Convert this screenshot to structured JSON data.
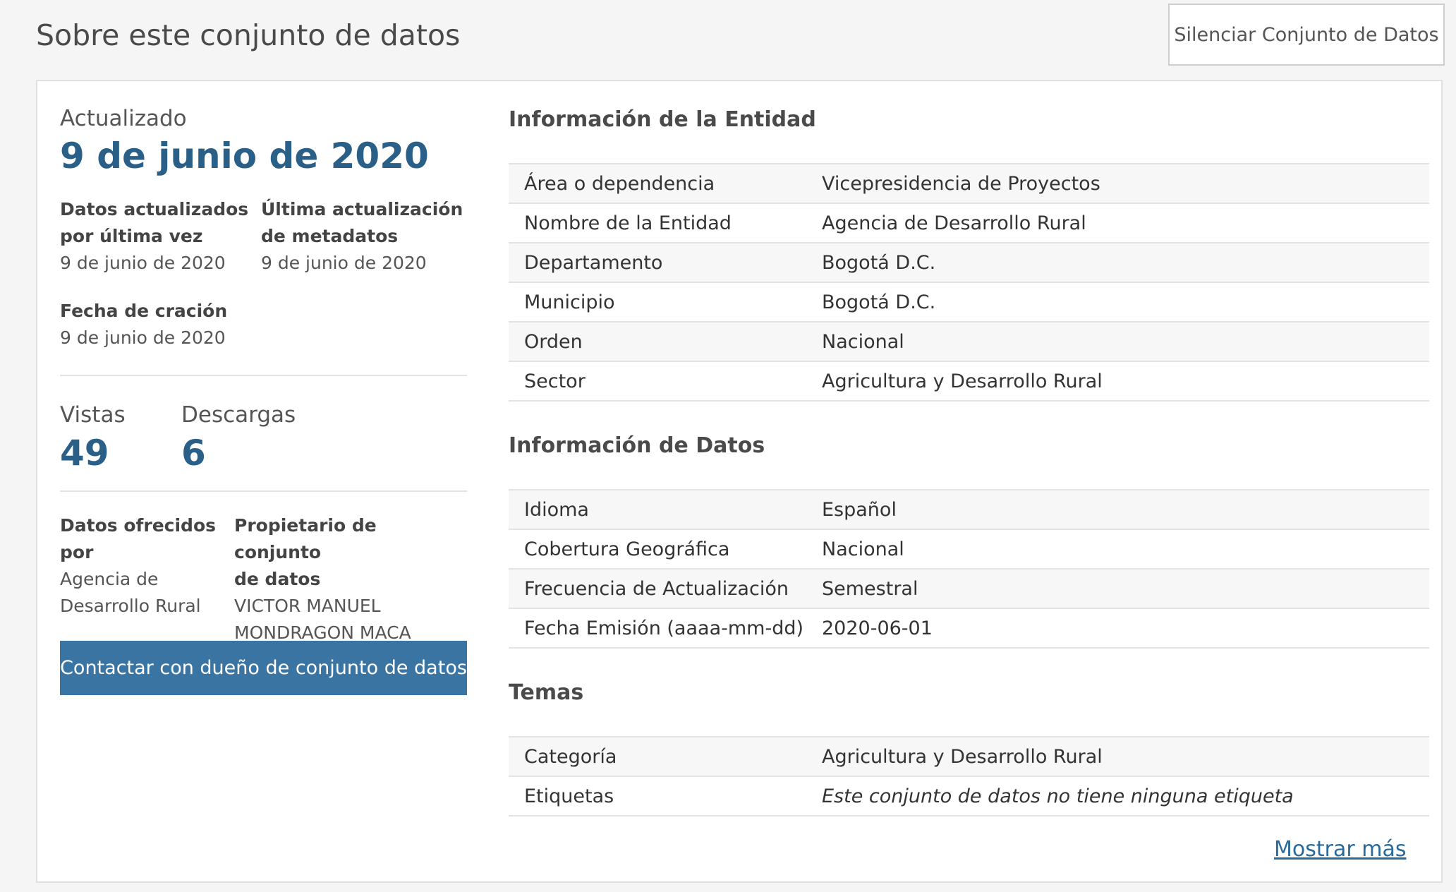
{
  "header": {
    "title": "Sobre este conjunto de datos",
    "mute_button_label": "Silenciar Conjunto de Datos"
  },
  "summary": {
    "updated_label": "Actualizado",
    "updated_date": "9 de junio de 2020",
    "data_updated_label_1": "Datos actualizados",
    "data_updated_label_2": "por última vez",
    "data_updated_value": "9 de junio de 2020",
    "metadata_updated_label_1": "Última actualización",
    "metadata_updated_label_2": "de metadatos",
    "metadata_updated_value": "9 de junio de 2020",
    "created_label": "Fecha de cración",
    "created_value": "9 de junio de 2020",
    "views_label": "Vistas",
    "views_value": "49",
    "downloads_label": "Descargas",
    "downloads_value": "6",
    "offered_by_label_1": "Datos ofrecidos",
    "offered_by_label_2": "por",
    "offered_by_value_1": "Agencia de",
    "offered_by_value_2": "Desarrollo Rural",
    "owner_label_1": "Propietario de conjunto",
    "owner_label_2": "de datos",
    "owner_value_1": "VICTOR MANUEL",
    "owner_value_2": "MONDRAGON MACA",
    "contact_button_label": "Contactar con dueño de conjunto de datos"
  },
  "entity_info": {
    "title": "Información de la Entidad",
    "rows": [
      {
        "key": "Área o dependencia",
        "value": "Vicepresidencia de Proyectos"
      },
      {
        "key": "Nombre de la Entidad",
        "value": "Agencia de Desarrollo Rural"
      },
      {
        "key": "Departamento",
        "value": "Bogotá D.C."
      },
      {
        "key": "Municipio",
        "value": "Bogotá D.C."
      },
      {
        "key": "Orden",
        "value": "Nacional"
      },
      {
        "key": "Sector",
        "value": "Agricultura y Desarrollo Rural"
      }
    ]
  },
  "data_info": {
    "title": "Información de Datos",
    "rows": [
      {
        "key": "Idioma",
        "value": "Español"
      },
      {
        "key": "Cobertura Geográfica",
        "value": "Nacional"
      },
      {
        "key": "Frecuencia de Actualización",
        "value": "Semestral"
      },
      {
        "key": "Fecha Emisión (aaaa-mm-dd)",
        "value": "2020-06-01"
      }
    ]
  },
  "topics": {
    "title": "Temas",
    "rows": [
      {
        "key": "Categoría",
        "value": "Agricultura y Desarrollo Rural"
      },
      {
        "key": "Etiquetas",
        "value": "Este conjunto de datos no tiene ninguna etiqueta"
      }
    ]
  },
  "show_more_label": "Mostrar más",
  "colors": {
    "accent_blue": "#2a5f87",
    "button_blue": "#3a74a2",
    "link_blue": "#2a6a9a"
  }
}
